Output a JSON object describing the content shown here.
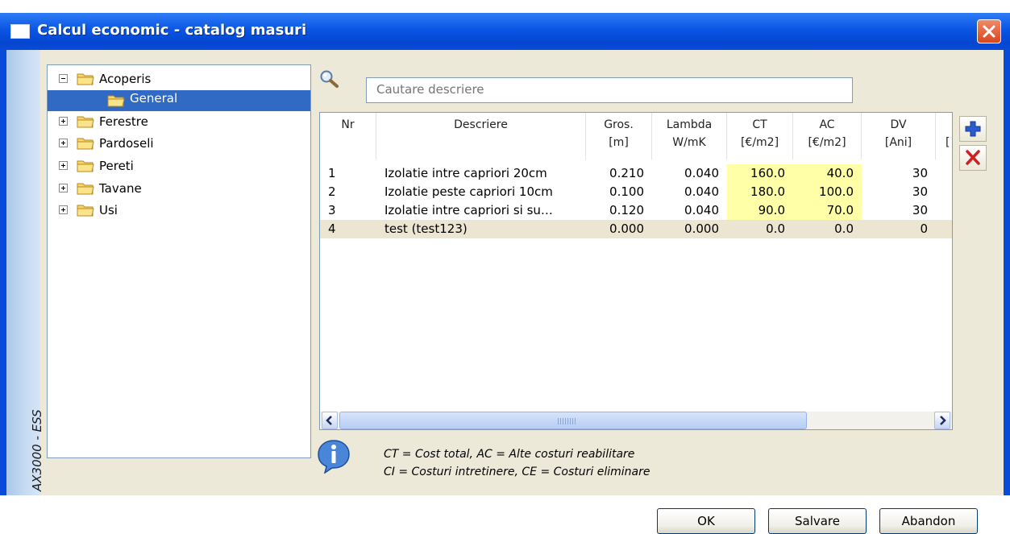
{
  "window": {
    "title": "Calcul economic - catalog masuri",
    "sidebar_text": "AX3000 - ESS"
  },
  "tree": {
    "items": [
      {
        "label": "Acoperis",
        "state": "expanded"
      },
      {
        "label": "General",
        "state": "selected"
      },
      {
        "label": "Ferestre",
        "state": "collapsed"
      },
      {
        "label": "Pardoseli",
        "state": "collapsed"
      },
      {
        "label": "Pereti",
        "state": "collapsed"
      },
      {
        "label": "Tavane",
        "state": "collapsed"
      },
      {
        "label": "Usi",
        "state": "collapsed"
      }
    ]
  },
  "search": {
    "placeholder": "Cautare descriere",
    "icon": "magnifier-icon"
  },
  "table": {
    "columns": [
      {
        "line1": "Nr",
        "line2": ""
      },
      {
        "line1": "Descriere",
        "line2": ""
      },
      {
        "line1": "Gros.",
        "line2": "[m]"
      },
      {
        "line1": "Lambda",
        "line2": "W/mK"
      },
      {
        "line1": "CT",
        "line2": "[€/m2]"
      },
      {
        "line1": "AC",
        "line2": "[€/m2]"
      },
      {
        "line1": "DV",
        "line2": "[Ani]"
      },
      {
        "line1": "",
        "line2": "["
      }
    ],
    "rows": [
      {
        "nr": "1",
        "descriere": "Izolatie intre capriori 20cm",
        "gros": "0.210",
        "lambda": "0.040",
        "ct": "160.0",
        "ac": "40.0",
        "dv": "30"
      },
      {
        "nr": "2",
        "descriere": "Izolatie peste capriori 10cm",
        "gros": "0.100",
        "lambda": "0.040",
        "ct": "180.0",
        "ac": "100.0",
        "dv": "30"
      },
      {
        "nr": "3",
        "descriere": "Izolatie intre capriori si su…",
        "gros": "0.120",
        "lambda": "0.040",
        "ct": "90.0",
        "ac": "70.0",
        "dv": "30"
      },
      {
        "nr": "4",
        "descriere": "test (test123)",
        "gros": "0.000",
        "lambda": "0.000",
        "ct": "0.0",
        "ac": "0.0",
        "dv": "0"
      }
    ],
    "selected_row": 4,
    "highlight_color": "#ffffa8"
  },
  "legend": {
    "line1": "CT = Cost total, AC = Alte costuri reabilitare",
    "line2": "CI = Costuri intretinere, CE = Costuri eliminare"
  },
  "buttons": {
    "ok": "OK",
    "save": "Salvare",
    "cancel": "Abandon"
  },
  "colors": {
    "title_bar": "#0a4ad8",
    "add_icon": "#2a5bd0",
    "delete_icon": "#cc2222"
  }
}
